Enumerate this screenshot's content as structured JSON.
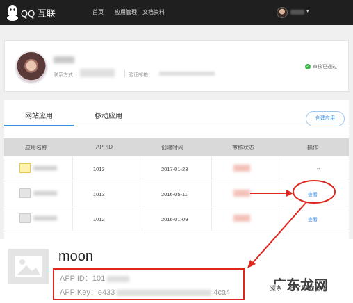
{
  "topbar": {
    "brand": "QQ 互联",
    "nav": [
      "首页",
      "应用管理",
      "文档资料"
    ],
    "caret": "▾"
  },
  "profile": {
    "contact_label": "联系方式：",
    "email_label": "验证邮箱：",
    "status_text": "审核已通过",
    "status_icon": "check-circle-icon"
  },
  "tabs": {
    "web": "网站应用",
    "mobile": "移动应用",
    "create_button": "创建应用"
  },
  "table": {
    "headers": [
      "应用名称",
      "APPID",
      "创建时间",
      "审核状态",
      "操作"
    ],
    "rows": [
      {
        "appid": "1013",
        "created": "2017-01-23",
        "op": "--"
      },
      {
        "appid": "1013",
        "created": "2016-05-11",
        "op": "查看"
      },
      {
        "appid": "1012",
        "created": "2016-01-09",
        "op": "查看"
      }
    ]
  },
  "callout": {
    "app_name": "moon",
    "app_id_label": "APP ID：101",
    "app_key_prefix": "APP Key：e433",
    "app_key_suffix": "4ca4"
  },
  "watermark": {
    "big": "广东龙网",
    "small": "头条",
    "url": "@了愿欧雨网"
  },
  "colors": {
    "accent": "#3a8ee6",
    "highlight": "#e0261d",
    "success": "#3bb54a",
    "nav_bg": "#1f1f1f"
  }
}
